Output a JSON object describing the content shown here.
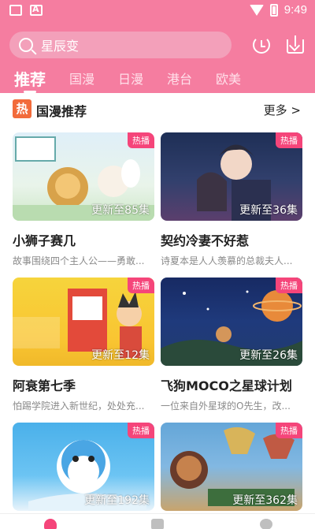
{
  "status_bar": {
    "time": "9:49"
  },
  "search": {
    "placeholder": "星辰变"
  },
  "tabs": [
    {
      "label": "推荐",
      "active": true
    },
    {
      "label": "国漫",
      "active": false
    },
    {
      "label": "日漫",
      "active": false
    },
    {
      "label": "港台",
      "active": false
    },
    {
      "label": "欧美",
      "active": false
    }
  ],
  "section": {
    "badge": "热",
    "title": "国漫推荐",
    "more": "更多 >"
  },
  "cards": [
    {
      "badge": "热播",
      "progress": "更新至85集",
      "title": "小狮子赛几",
      "desc": "故事围绕四个主人公——勇敢..."
    },
    {
      "badge": "热播",
      "progress": "更新至36集",
      "title": "契约冷妻不好惹",
      "desc": "诗夏本是人人羡慕的总裁夫人..."
    },
    {
      "badge": "热播",
      "progress": "更新至12集",
      "title": "阿衰第七季",
      "desc": "怕踢学院进入新世纪，处处充..."
    },
    {
      "badge": "热播",
      "progress": "更新至26集",
      "title": "飞狗MOCO之星球计划",
      "desc": "一位来自外星球的O先生，改..."
    },
    {
      "badge": "热播",
      "progress": "更新至192集",
      "title": "",
      "desc": ""
    },
    {
      "badge": "热播",
      "progress": "更新至362集",
      "title": "",
      "desc": ""
    }
  ],
  "colors": {
    "brand": "#f57da0",
    "hot": "#f5457a",
    "badge_orange": "#f26b3b"
  }
}
